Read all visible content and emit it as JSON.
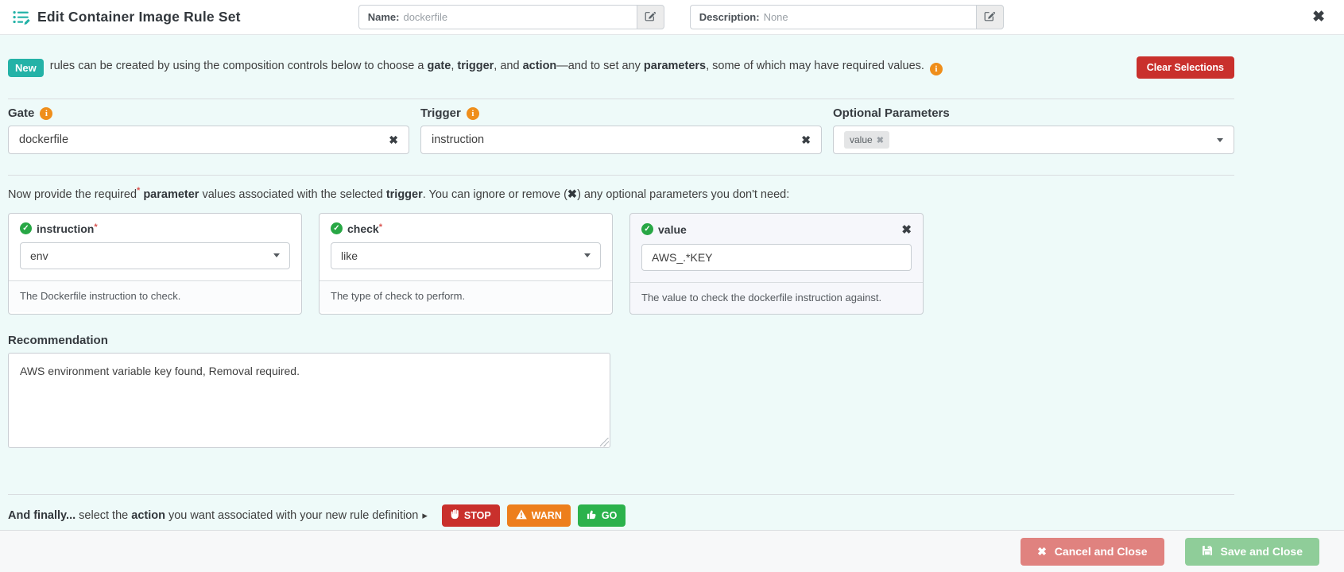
{
  "header": {
    "title": "Edit Container Image Rule Set",
    "name_field": {
      "label": "Name:",
      "value": "dockerfile"
    },
    "description_field": {
      "label": "Description:",
      "value": "None"
    },
    "close_glyph": "✖"
  },
  "banner": {
    "badge": "New",
    "t1": "rules can be created by using the composition controls below to choose a ",
    "b_gate": "gate",
    "t2": ", ",
    "b_trigger": "trigger",
    "t3": ", and ",
    "b_action": "action",
    "t4": "—and to set any ",
    "b_parameters": "parameters",
    "t5": ", some of which may have required values.",
    "info_glyph": "i",
    "clear_button": "Clear Selections"
  },
  "composition": {
    "gate": {
      "label": "Gate",
      "value": "dockerfile",
      "clear_glyph": "✖"
    },
    "trigger": {
      "label": "Trigger",
      "value": "instruction",
      "clear_glyph": "✖"
    },
    "optional": {
      "label": "Optional Parameters",
      "tag": "value",
      "tag_remove_glyph": "✖"
    }
  },
  "intro": {
    "t1": "Now provide the required",
    "star": "*",
    "b1": "parameter",
    "t2": " values associated with the selected ",
    "b2": "trigger",
    "t3": ". You can ignore or remove (",
    "b3": "✖",
    "t4": ") any optional parameters you don't need:"
  },
  "cards": [
    {
      "name": "instruction",
      "star": "*",
      "check_glyph": "✓",
      "value": "env",
      "help": "The Dockerfile instruction to check."
    },
    {
      "name": "check",
      "star": "*",
      "check_glyph": "✓",
      "value": "like",
      "help": "The type of check to perform."
    },
    {
      "name": "value",
      "check_glyph": "✓",
      "remove_glyph": "✖",
      "value": "AWS_.*KEY",
      "help": "The value to check the dockerfile instruction against."
    }
  ],
  "recommendation": {
    "label": "Recommendation",
    "value": "AWS environment variable key found, Removal required."
  },
  "finale": {
    "b1": "And finally...",
    "t1": " select the ",
    "b2": "action",
    "t2": " you want associated with your new rule definition ",
    "pointer_glyph": "▸",
    "buttons": [
      {
        "label": "STOP"
      },
      {
        "label": "WARN"
      },
      {
        "label": "GO"
      }
    ]
  },
  "footer": {
    "cancel_label": "Cancel and Close",
    "cancel_glyph": "✖",
    "save_label": "Save and Close"
  },
  "colors": {
    "teal_accent": "#24b2a7",
    "info_orange": "#ef8e1b",
    "danger_red": "#c9302c",
    "warn_orange": "#ed7f1c",
    "go_green": "#2bb24c",
    "check_green": "#28a745",
    "cancel_muted_red": "#e0827f",
    "save_muted_green": "#8fcd99",
    "page_background": "#eefaf9"
  }
}
